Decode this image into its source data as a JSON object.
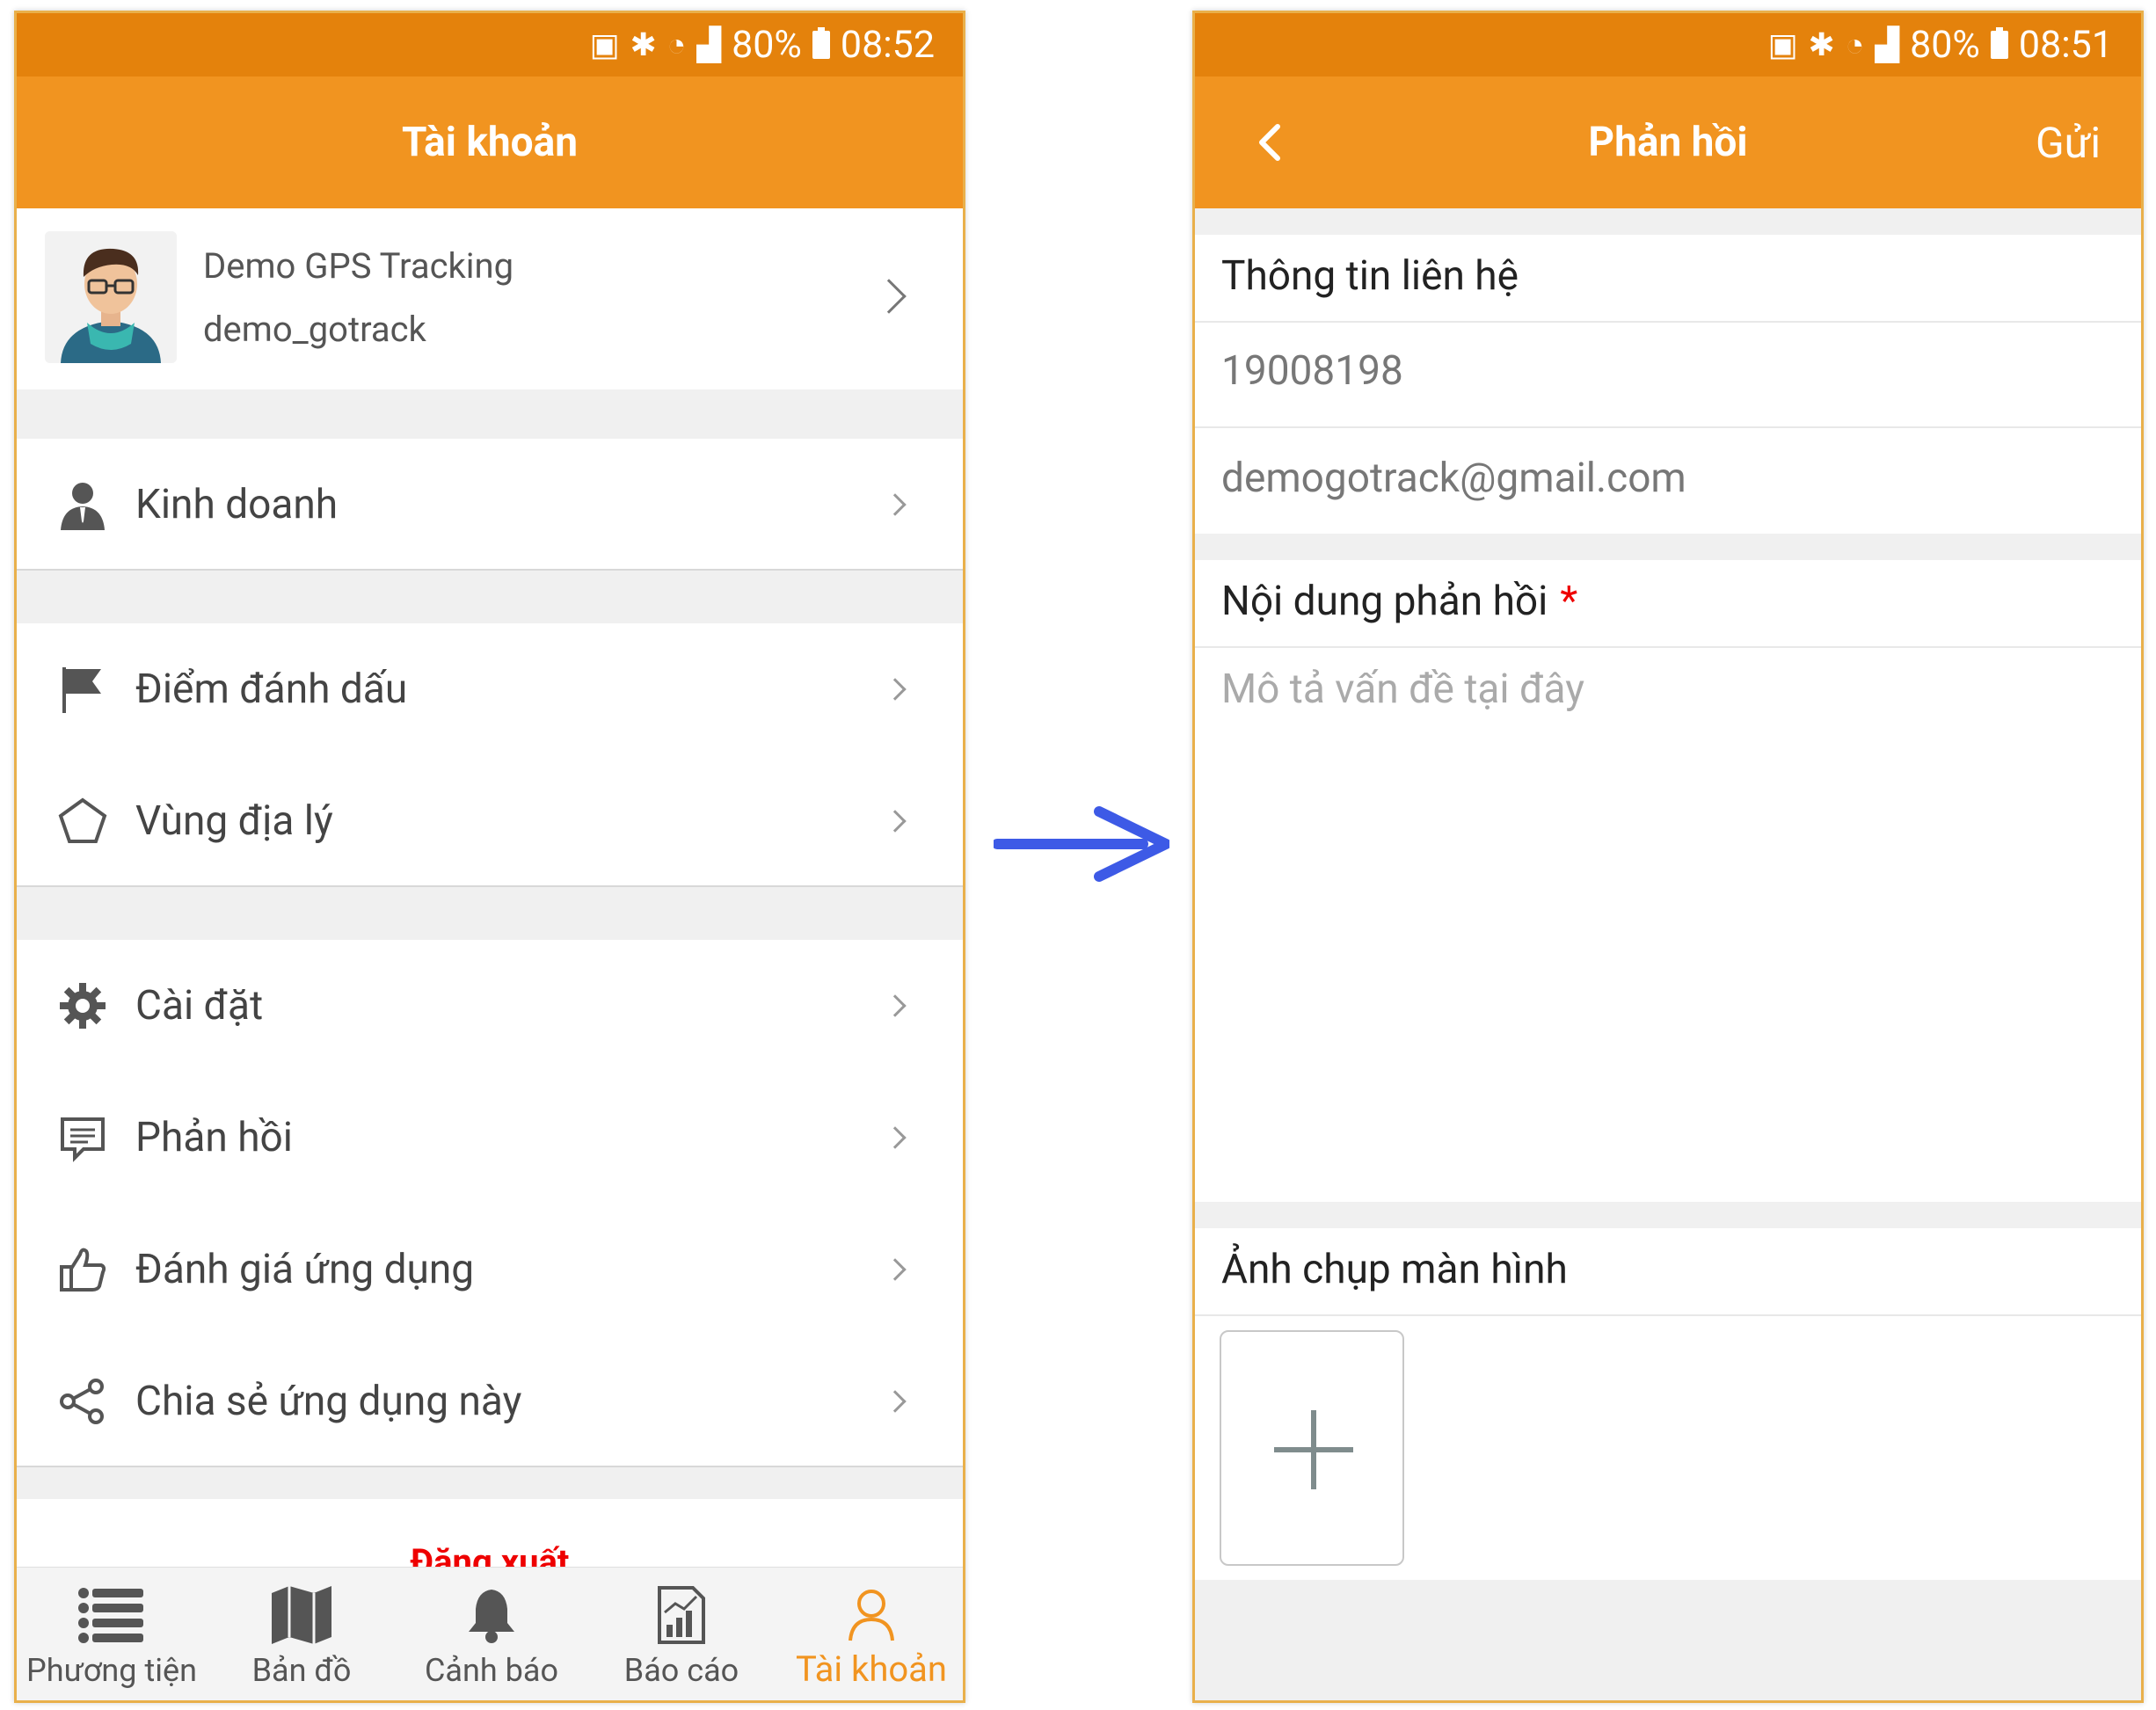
{
  "left": {
    "status": {
      "battery": "80%",
      "time": "08:52"
    },
    "title": "Tài khoản",
    "profile": {
      "name": "Demo GPS Tracking",
      "username": "demo_gotrack"
    },
    "menu": [
      {
        "label": "Kinh doanh",
        "icon": "person-icon"
      },
      {
        "label": "Điểm đánh dấu",
        "icon": "flag-icon"
      },
      {
        "label": "Vùng địa lý",
        "icon": "pentagon-icon"
      },
      {
        "label": "Cài đặt",
        "icon": "gear-icon"
      },
      {
        "label": "Phản hồi",
        "icon": "feedback-icon"
      },
      {
        "label": "Đánh giá ứng dụng",
        "icon": "thumbs-up-icon"
      },
      {
        "label": "Chia sẻ ứng dụng này",
        "icon": "share-icon"
      }
    ],
    "logout": "Đăng xuất",
    "tabs": [
      {
        "label": "Phương tiện",
        "icon": "list-icon"
      },
      {
        "label": "Bản đồ",
        "icon": "map-icon"
      },
      {
        "label": "Cảnh báo",
        "icon": "bell-icon"
      },
      {
        "label": "Báo cáo",
        "icon": "report-icon"
      },
      {
        "label": "Tài khoản",
        "icon": "account-icon",
        "active": true
      }
    ],
    "colors": {
      "accent": "#f19420",
      "statusbar": "#e4820c",
      "logout": "#e00000"
    }
  },
  "right": {
    "status": {
      "battery": "80%",
      "time": "08:51"
    },
    "title": "Phản hồi",
    "send": "Gửi",
    "contact": {
      "heading": "Thông tin liên hệ",
      "phone": "19008198",
      "email": "demogotrack@gmail.com"
    },
    "feedback": {
      "heading": "Nội dung phản hồi",
      "required_mark": "*",
      "placeholder": "Mô tả vấn đề tại đây"
    },
    "screenshot": {
      "heading": "Ảnh chụp màn hình"
    }
  }
}
